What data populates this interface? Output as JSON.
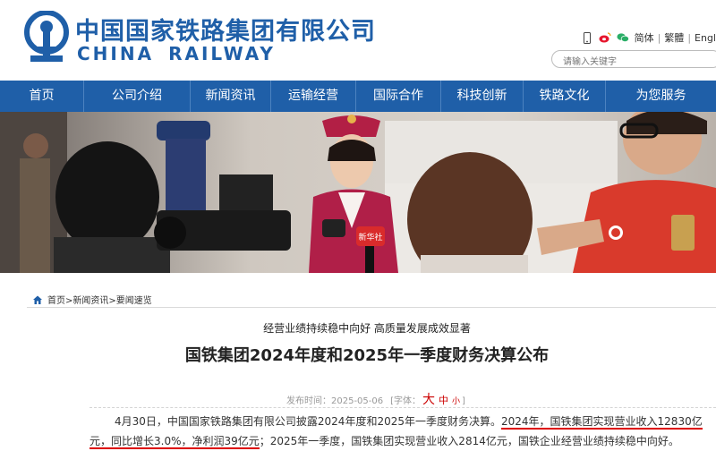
{
  "header": {
    "cn_name": "中国国家铁路集团有限公司",
    "en_name_1": "CHINA",
    "en_name_2": "RAILWAY",
    "links": [
      "简体",
      "繁體",
      "Engl"
    ],
    "search_placeholder": "请输入关键字",
    "icons": [
      "mobile-icon",
      "weibo-icon",
      "wechat-icon"
    ],
    "brand_color": "#1f5fa8"
  },
  "nav": {
    "items": [
      "首页",
      "公司介绍",
      "新闻资讯",
      "运输经营",
      "国际合作",
      "科技创新",
      "铁路文化",
      "为您服务"
    ]
  },
  "banner": {
    "mic_label": "新华社"
  },
  "breadcrumb": {
    "text": "首页>新闻资讯>要闻速览"
  },
  "article": {
    "subtitle": "经营业绩持续稳中向好 高质量发展成效显著",
    "title": "国铁集团2024年度和2025年一季度财务决算公布",
    "meta_label": "发布时间：",
    "date": "2025-05-06",
    "font_label": "[字体：",
    "font_big": "大",
    "font_mid": "中",
    "font_small": "小",
    "font_close": "]",
    "line1_a": "4月30日，中国国家铁路集团有限公司披露2024年度和2025年一季度财务决算。",
    "line1_b": "2024年，国铁集团实现营业收入12830亿",
    "line2_a": "元，同比增长3.0%，净利润39亿元",
    "line2_b": "；2025年一季度，国铁集团实现营业收入2814亿元，国铁企业经营业绩持续稳中向好。"
  }
}
